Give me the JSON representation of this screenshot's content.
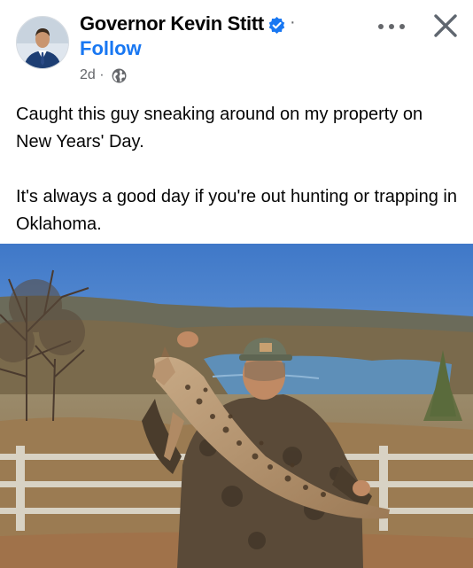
{
  "post": {
    "author": "Governor Kevin Stitt",
    "follow_label": "Follow",
    "time_ago": "2d",
    "separator": "·",
    "text_paragraphs": [
      "Caught this guy sneaking around on my property on New Years' Day.",
      "It's always a good day if you're out hunting or trapping in Oklahoma."
    ]
  },
  "icons": {
    "verified": "verified-badge-icon",
    "privacy": "globe-icon",
    "more": "more-options-icon",
    "close": "close-icon"
  },
  "colors": {
    "accent": "#1877f2",
    "text": "#050505",
    "secondary_text": "#65676b",
    "background": "#ffffff"
  }
}
